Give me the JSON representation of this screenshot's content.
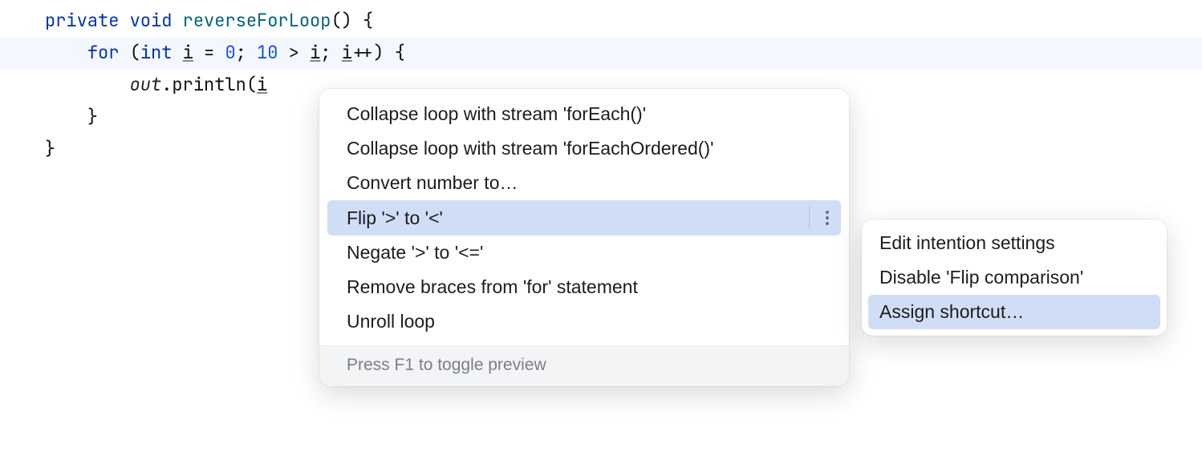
{
  "code": {
    "line1": {
      "kw_private": "private",
      "kw_void": "void",
      "fn_name": "reverseForLoop",
      "paren_brace": "() {"
    },
    "line2": {
      "kw_for": "for",
      "open": " (",
      "kw_int": "int",
      "var_i1": "i",
      "eq": " = ",
      "zero": "0",
      "semi1": "; ",
      "ten": "10",
      "gt": " > ",
      "var_i2": "i",
      "semi2": "; ",
      "var_i3": "i",
      "inc": "++) {"
    },
    "line3": {
      "obj_out": "out",
      "dot_println": ".println(",
      "var_i": "i"
    },
    "line4": {
      "close": "}"
    },
    "line5": {
      "close": "}"
    }
  },
  "intention": {
    "items": [
      "Collapse loop with stream 'forEach()'",
      "Collapse loop with stream 'forEachOrdered()'",
      "Convert number to…",
      "Flip '>' to '<'",
      "Negate '>' to '<='",
      "Remove braces from 'for' statement",
      "Unroll loop"
    ],
    "selected_index": 3,
    "footer": "Press F1 to toggle preview"
  },
  "submenu": {
    "items": [
      "Edit intention settings",
      "Disable 'Flip comparison'",
      "Assign shortcut…"
    ],
    "selected_index": 2
  },
  "icons": {
    "bulb": "lightbulb-icon"
  }
}
